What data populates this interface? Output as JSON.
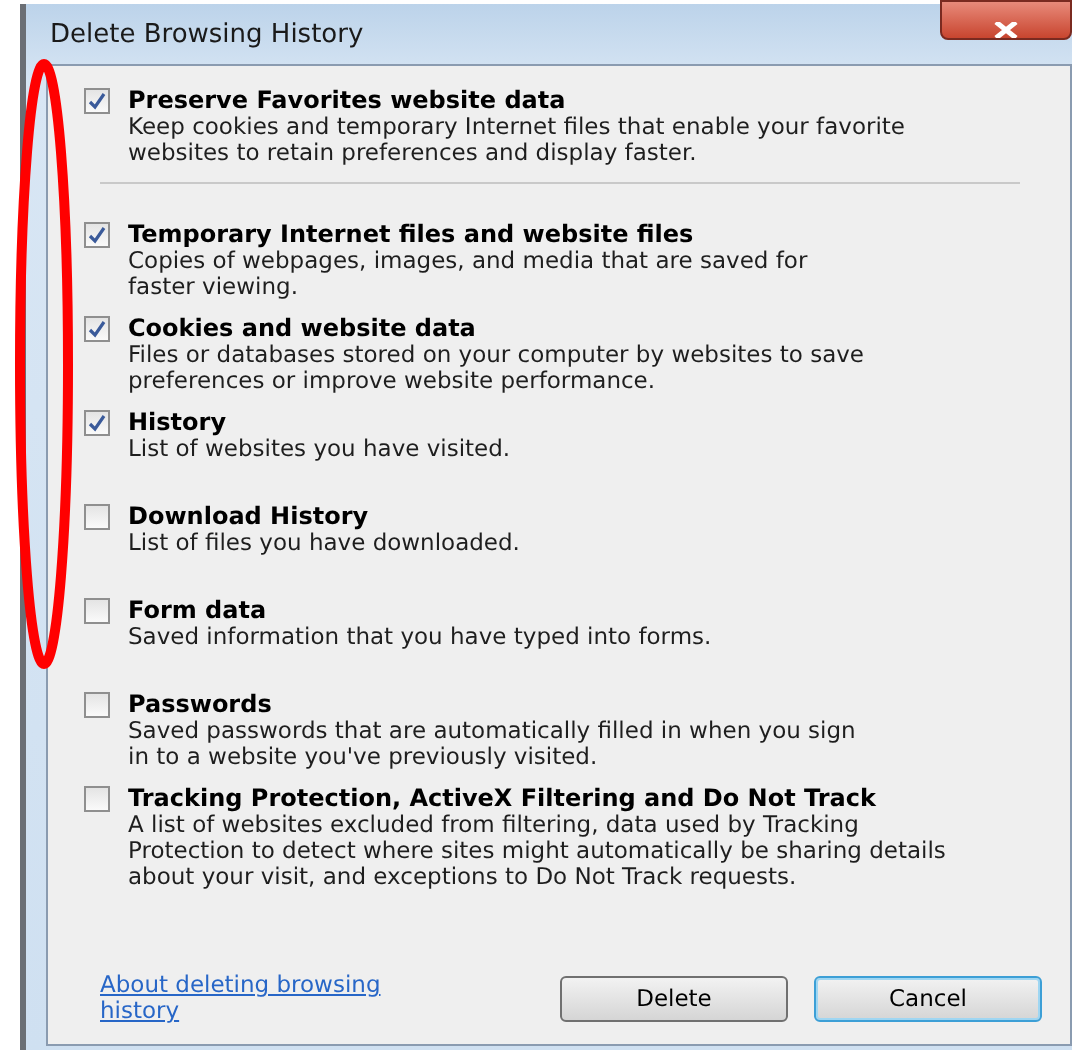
{
  "window": {
    "title": "Delete Browsing History"
  },
  "options": [
    {
      "label": "Preserve Favorites website data",
      "description": [
        "Keep cookies and temporary Internet files that enable your favorite",
        "websites to retain preferences and display faster."
      ],
      "checked": true,
      "separator_after": true
    },
    {
      "label": "Temporary Internet files and website files",
      "description": [
        "Copies of webpages, images, and media that are saved for",
        "faster viewing."
      ],
      "checked": true,
      "separator_after": false
    },
    {
      "label": "Cookies and website data",
      "description": [
        "Files or databases stored on your computer by websites to save",
        "preferences or improve website performance."
      ],
      "checked": true,
      "separator_after": false
    },
    {
      "label": "History",
      "description": [
        "List of websites you have visited."
      ],
      "checked": true,
      "separator_after": false
    },
    {
      "label": "Download History",
      "description": [
        "List of files you have downloaded."
      ],
      "checked": false,
      "separator_after": false
    },
    {
      "label": "Form data",
      "description": [
        "Saved information that you have typed into forms."
      ],
      "checked": false,
      "separator_after": false
    },
    {
      "label": "Passwords",
      "description": [
        "Saved passwords that are automatically filled in when you sign",
        "in to a website you've previously visited."
      ],
      "checked": false,
      "separator_after": false
    },
    {
      "label": "Tracking Protection, ActiveX Filtering and Do Not Track",
      "description": [
        "A list of websites excluded from filtering, data used by Tracking",
        "Protection to detect where sites might automatically be sharing details",
        "about your visit, and exceptions to Do Not Track requests."
      ],
      "checked": false,
      "separator_after": false
    }
  ],
  "help_link": "About deleting browsing history",
  "buttons": [
    {
      "label": "Delete",
      "focused": false
    },
    {
      "label": "Cancel",
      "focused": true
    }
  ]
}
